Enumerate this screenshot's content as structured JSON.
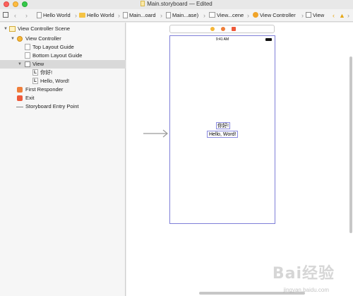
{
  "window": {
    "title": "Main.storyboard — Edited"
  },
  "jumpbar": {
    "items": [
      "Hello World",
      "Hello World",
      "Main...oard",
      "Main...ase)",
      "View...cene",
      "View Controller",
      "View"
    ]
  },
  "outline": {
    "rows": [
      "View Controller Scene",
      "View Controller",
      "Top Layout Guide",
      "Bottom Layout Guide",
      "View",
      "你好!",
      "Hello, Word!",
      "First Responder",
      "Exit",
      "Storyboard Entry Point"
    ],
    "label_glyph": "L"
  },
  "canvas": {
    "status_time": "9:41 AM",
    "label_cn": "你好!",
    "label_en": "Hello, Word!"
  },
  "watermark": {
    "text": "Bai经验",
    "sub": "jingyan.baidu.com"
  },
  "colors": {
    "selection_border": "#7f7fd8",
    "selected_row": "#d9d9d9"
  }
}
